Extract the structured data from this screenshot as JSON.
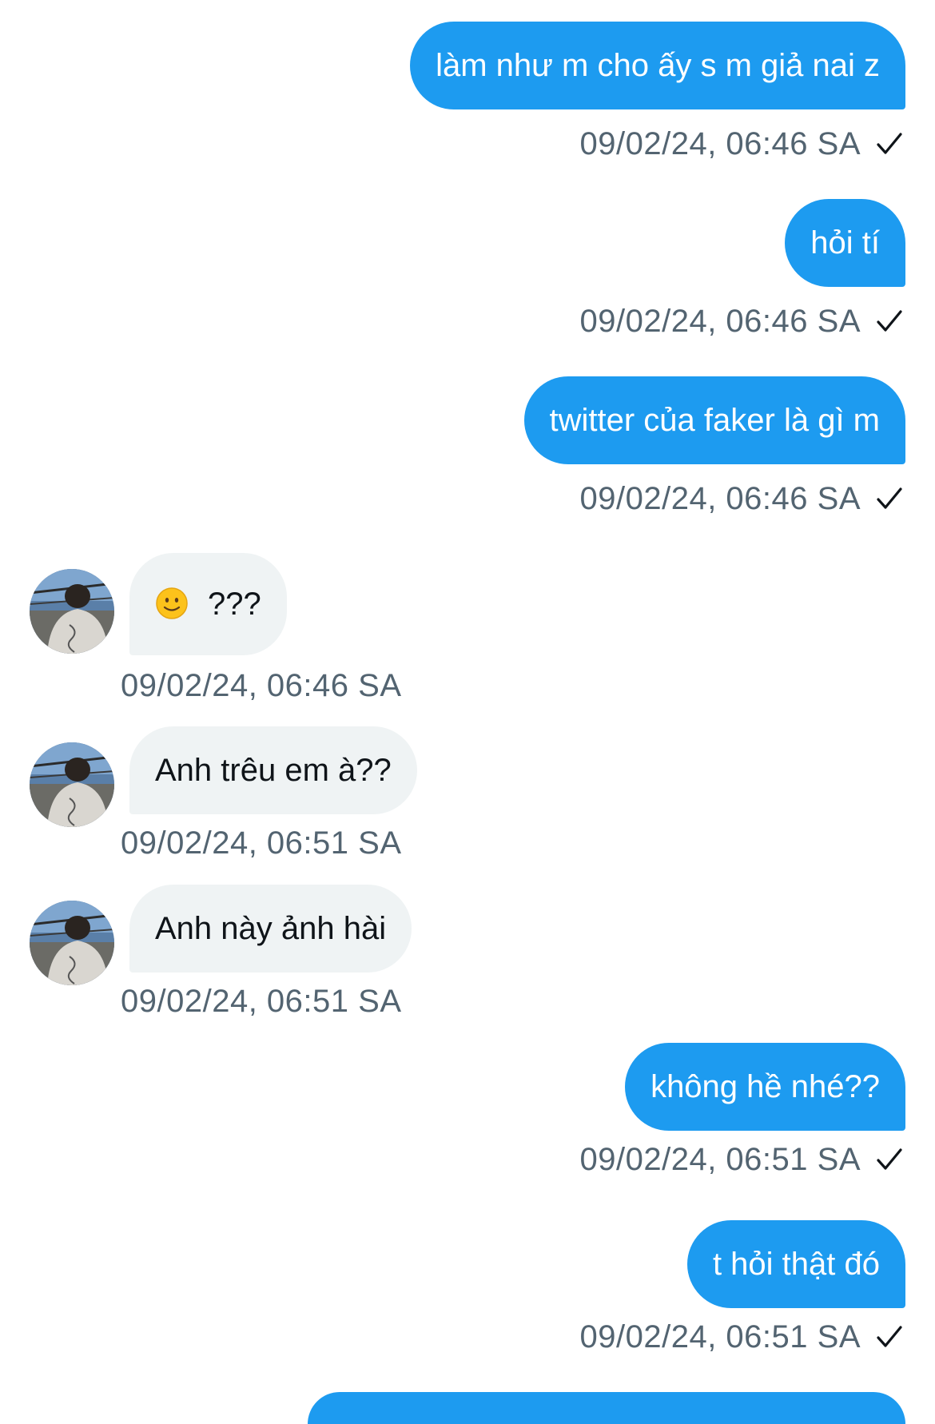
{
  "colors": {
    "outgoing_bubble": "#1d9bf0",
    "incoming_bubble": "#eff3f4",
    "timestamp": "#536471",
    "incoming_text": "#0f1419"
  },
  "messages": [
    {
      "direction": "out",
      "text": "làm như m cho ấy s m giả nai z",
      "time": "09/02/24, 06:46 SA",
      "status_icon": "check-icon"
    },
    {
      "direction": "out",
      "text": "hỏi tí",
      "time": "09/02/24, 06:46 SA",
      "status_icon": "check-icon"
    },
    {
      "direction": "out",
      "text": "twitter của faker là gì m",
      "time": "09/02/24, 06:46 SA",
      "status_icon": "check-icon"
    },
    {
      "direction": "in",
      "text": "???",
      "emoji": "slightly-smiling-face-icon",
      "time": "09/02/24, 06:46 SA"
    },
    {
      "direction": "in",
      "text": "Anh trêu em à??",
      "time": "09/02/24, 06:51 SA"
    },
    {
      "direction": "in",
      "text": "Anh này ảnh hài",
      "time": "09/02/24, 06:51 SA"
    },
    {
      "direction": "out",
      "text": "không hề nhé??",
      "time": "09/02/24, 06:51 SA",
      "status_icon": "check-icon"
    },
    {
      "direction": "out",
      "text": "t hỏi thật đó",
      "time": "09/02/24, 06:51 SA",
      "status_icon": "check-icon"
    }
  ]
}
